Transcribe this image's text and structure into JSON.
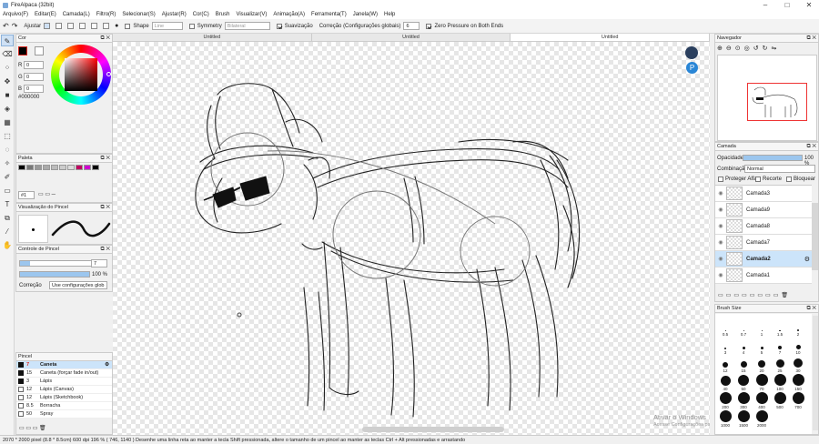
{
  "window": {
    "title": "FireAlpaca (32bit)"
  },
  "menu": [
    "Arquivo(F)",
    "Editar(E)",
    "Camada(L)",
    "Filtro(R)",
    "Selecionar(S)",
    "Ajustar(R)",
    "Cor(C)",
    "Brush",
    "Visualizar(V)",
    "Animação(A)",
    "Ferramenta(T)",
    "Janela(W)",
    "Help"
  ],
  "toolopts": {
    "ajustar": "Ajustar",
    "shape": "Shape",
    "shape_value": "Line",
    "symmetry": "Symmetry",
    "symmetry_value": "Bilateral",
    "suavizacao": "Suavização",
    "correcao": "Correção (Configurações globais)",
    "correcao_value": "6",
    "zero_pressure": "Zero Pressure on Both Ends"
  },
  "tabs": [
    "Untitled",
    "Untitled",
    "Untitled"
  ],
  "color_panel": {
    "title": "Cor",
    "r_label": "R",
    "g_label": "G",
    "b_label": "B",
    "r": "0",
    "g": "0",
    "b": "0",
    "hex": "#000000",
    "fg": "#000000",
    "accent": "#d8261e"
  },
  "palette_panel": {
    "title": "Paleta",
    "colors": [
      "#000000",
      "#777777",
      "#999999",
      "#aaaaaa",
      "#bbbbbb",
      "#cccccc",
      "#dddddd",
      "#c00060",
      "#d000d0",
      "#000000"
    ],
    "selector": "#1"
  },
  "brush_preview": {
    "title": "Visualização do Pincel"
  },
  "brush_control": {
    "title": "Controle de Pincel",
    "size": "7",
    "opacity": "100 %",
    "size_fill": 0.12,
    "opacity_fill": 1.0,
    "correction_label": "Correção",
    "correction_value": "Use configurações glob"
  },
  "brush_panel": {
    "title": "Pincel",
    "items": [
      {
        "size": "7",
        "name": "Caneta",
        "selected": true,
        "dark": true
      },
      {
        "size": "15",
        "name": "Caneta (forçar fade in/out)",
        "dark": true
      },
      {
        "size": "3",
        "name": "Lápis",
        "dark": true
      },
      {
        "size": "12",
        "name": "Lápis (Canvas)",
        "dark": false
      },
      {
        "size": "12",
        "name": "Lápis (Sketchbook)",
        "dark": false
      },
      {
        "size": "8.5",
        "name": "Borracha",
        "dark": false
      },
      {
        "size": "50",
        "name": "Spray",
        "dark": false
      }
    ]
  },
  "navigator": {
    "title": "Navegador"
  },
  "layer_panel": {
    "title": "Camada",
    "opacity_label": "Opacidade",
    "opacity_value": "100 %",
    "opacity_fill": 1.0,
    "blend_label": "Combinação",
    "blend_value": "Normal",
    "protect_alpha": "Proteger Alfa",
    "clipping": "Recorte",
    "lock": "Bloquear",
    "layers": [
      {
        "name": "Camada3",
        "selected": false
      },
      {
        "name": "Camada9",
        "selected": false
      },
      {
        "name": "Camada8",
        "selected": false
      },
      {
        "name": "Camada7",
        "selected": false
      },
      {
        "name": "Camada2",
        "selected": true
      },
      {
        "name": "Camada1",
        "selected": false
      }
    ]
  },
  "brush_size_panel": {
    "title": "Brush Size",
    "sizes": [
      "0.5",
      "0.7",
      "1",
      "1.5",
      "2",
      "3",
      "4",
      "5",
      "7",
      "10",
      "12",
      "15",
      "20",
      "25",
      "30",
      "40",
      "50",
      "70",
      "100",
      "150",
      "200",
      "300",
      "400",
      "500",
      "700",
      "1000",
      "1500",
      "2000"
    ]
  },
  "status": {
    "text": "2070 * 2000 pixel   (8.8 * 8.5cm)   600 dpi   196 %   ( 746, 1140 )   Desenhe uma linha reta ao manter a tecla Shift pressionada, altere o tamanho de um pincel ao manter as teclas Ctrl + Alt pressionadas e arrastando"
  },
  "watermark": {
    "line1": "Ativar o Windows",
    "line2": "Acesse Configurações para ativar o Windows."
  }
}
